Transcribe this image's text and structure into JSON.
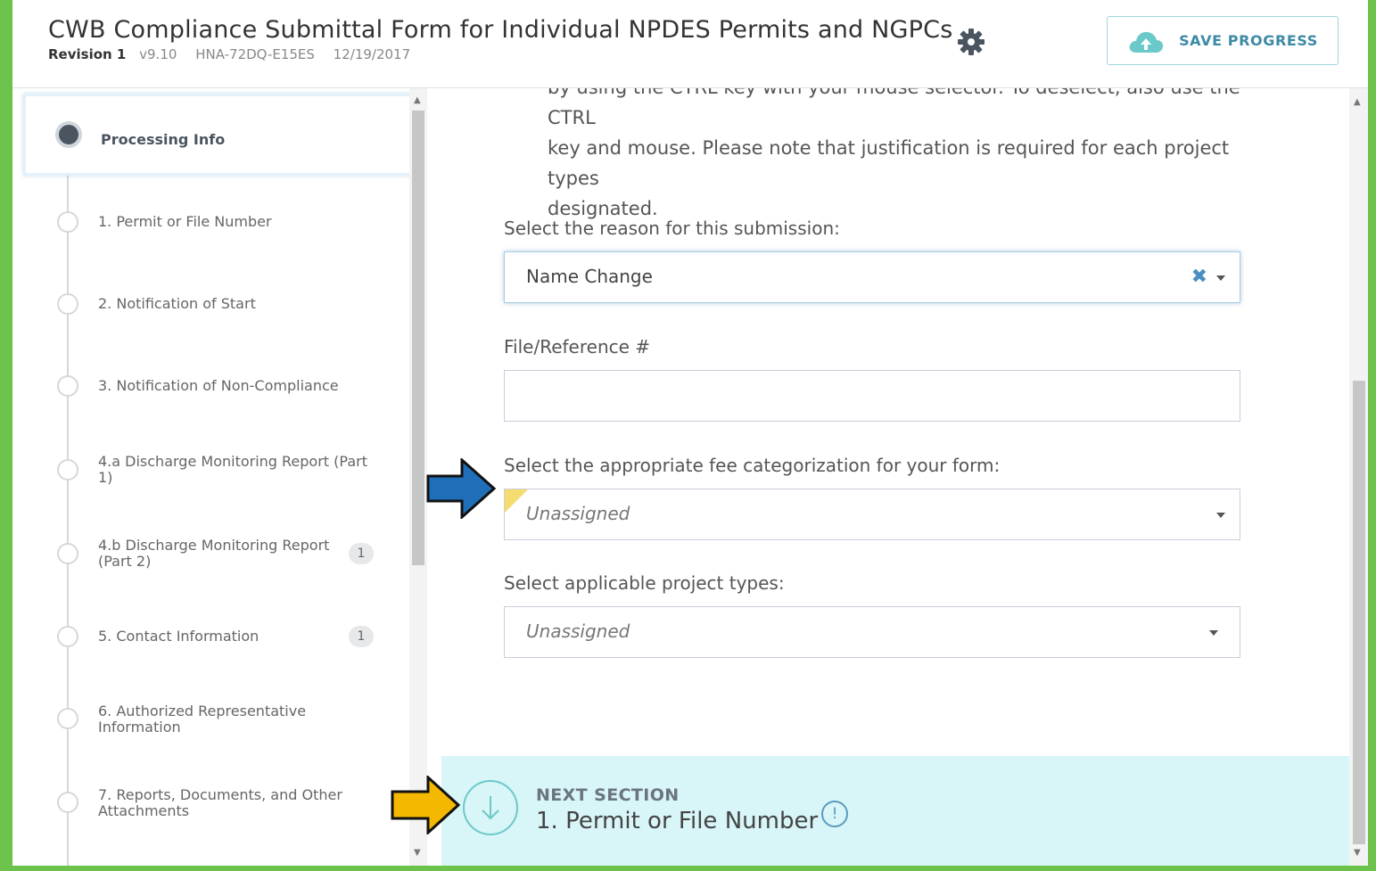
{
  "header": {
    "title": "CWB Compliance Submittal Form for Individual NPDES Permits and NGPCs",
    "revision": "Revision 1",
    "version": "v9.10",
    "form_id": "HNA-72DQ-E15ES",
    "date": "12/19/2017",
    "save_label": "SAVE PROGRESS"
  },
  "sidebar": {
    "items": [
      {
        "label": "Processing Info",
        "state": "active"
      },
      {
        "label": "1. Permit or File Number"
      },
      {
        "label": "2. Notification of Start"
      },
      {
        "label": "3. Notification of Non-Compliance"
      },
      {
        "label": "4.a Discharge Monitoring Report (Part 1)"
      },
      {
        "label": "4.b Discharge Monitoring Report (Part 2)",
        "badge": "1"
      },
      {
        "label": "5. Contact Information",
        "badge": "1"
      },
      {
        "label": "6. Authorized Representative Information"
      },
      {
        "label": "7. Reports, Documents, and Other Attachments"
      }
    ]
  },
  "main": {
    "intro_lines": [
      "by using the CTRL key with your mouse selector. To deselect, also use the CTRL",
      "key and mouse. Please note that justification is required for each project types",
      "designated."
    ],
    "fields": {
      "reason": {
        "label": "Select the reason for this submission:",
        "value": "Name Change"
      },
      "file_ref": {
        "label": "File/Reference #",
        "value": ""
      },
      "fee": {
        "label": "Select the appropriate fee categorization for your form:",
        "value": "Unassigned"
      },
      "project_types": {
        "label": "Select applicable project types:",
        "value": "Unassigned"
      }
    },
    "next_section": {
      "kicker": "NEXT SECTION",
      "title": "1. Permit or File Number",
      "info_glyph": "!"
    }
  },
  "colors": {
    "accent": "#6cc24a",
    "next_bg": "#d8f5f7",
    "callout_blue": "#1f6fb8",
    "callout_yellow": "#f5b800"
  }
}
